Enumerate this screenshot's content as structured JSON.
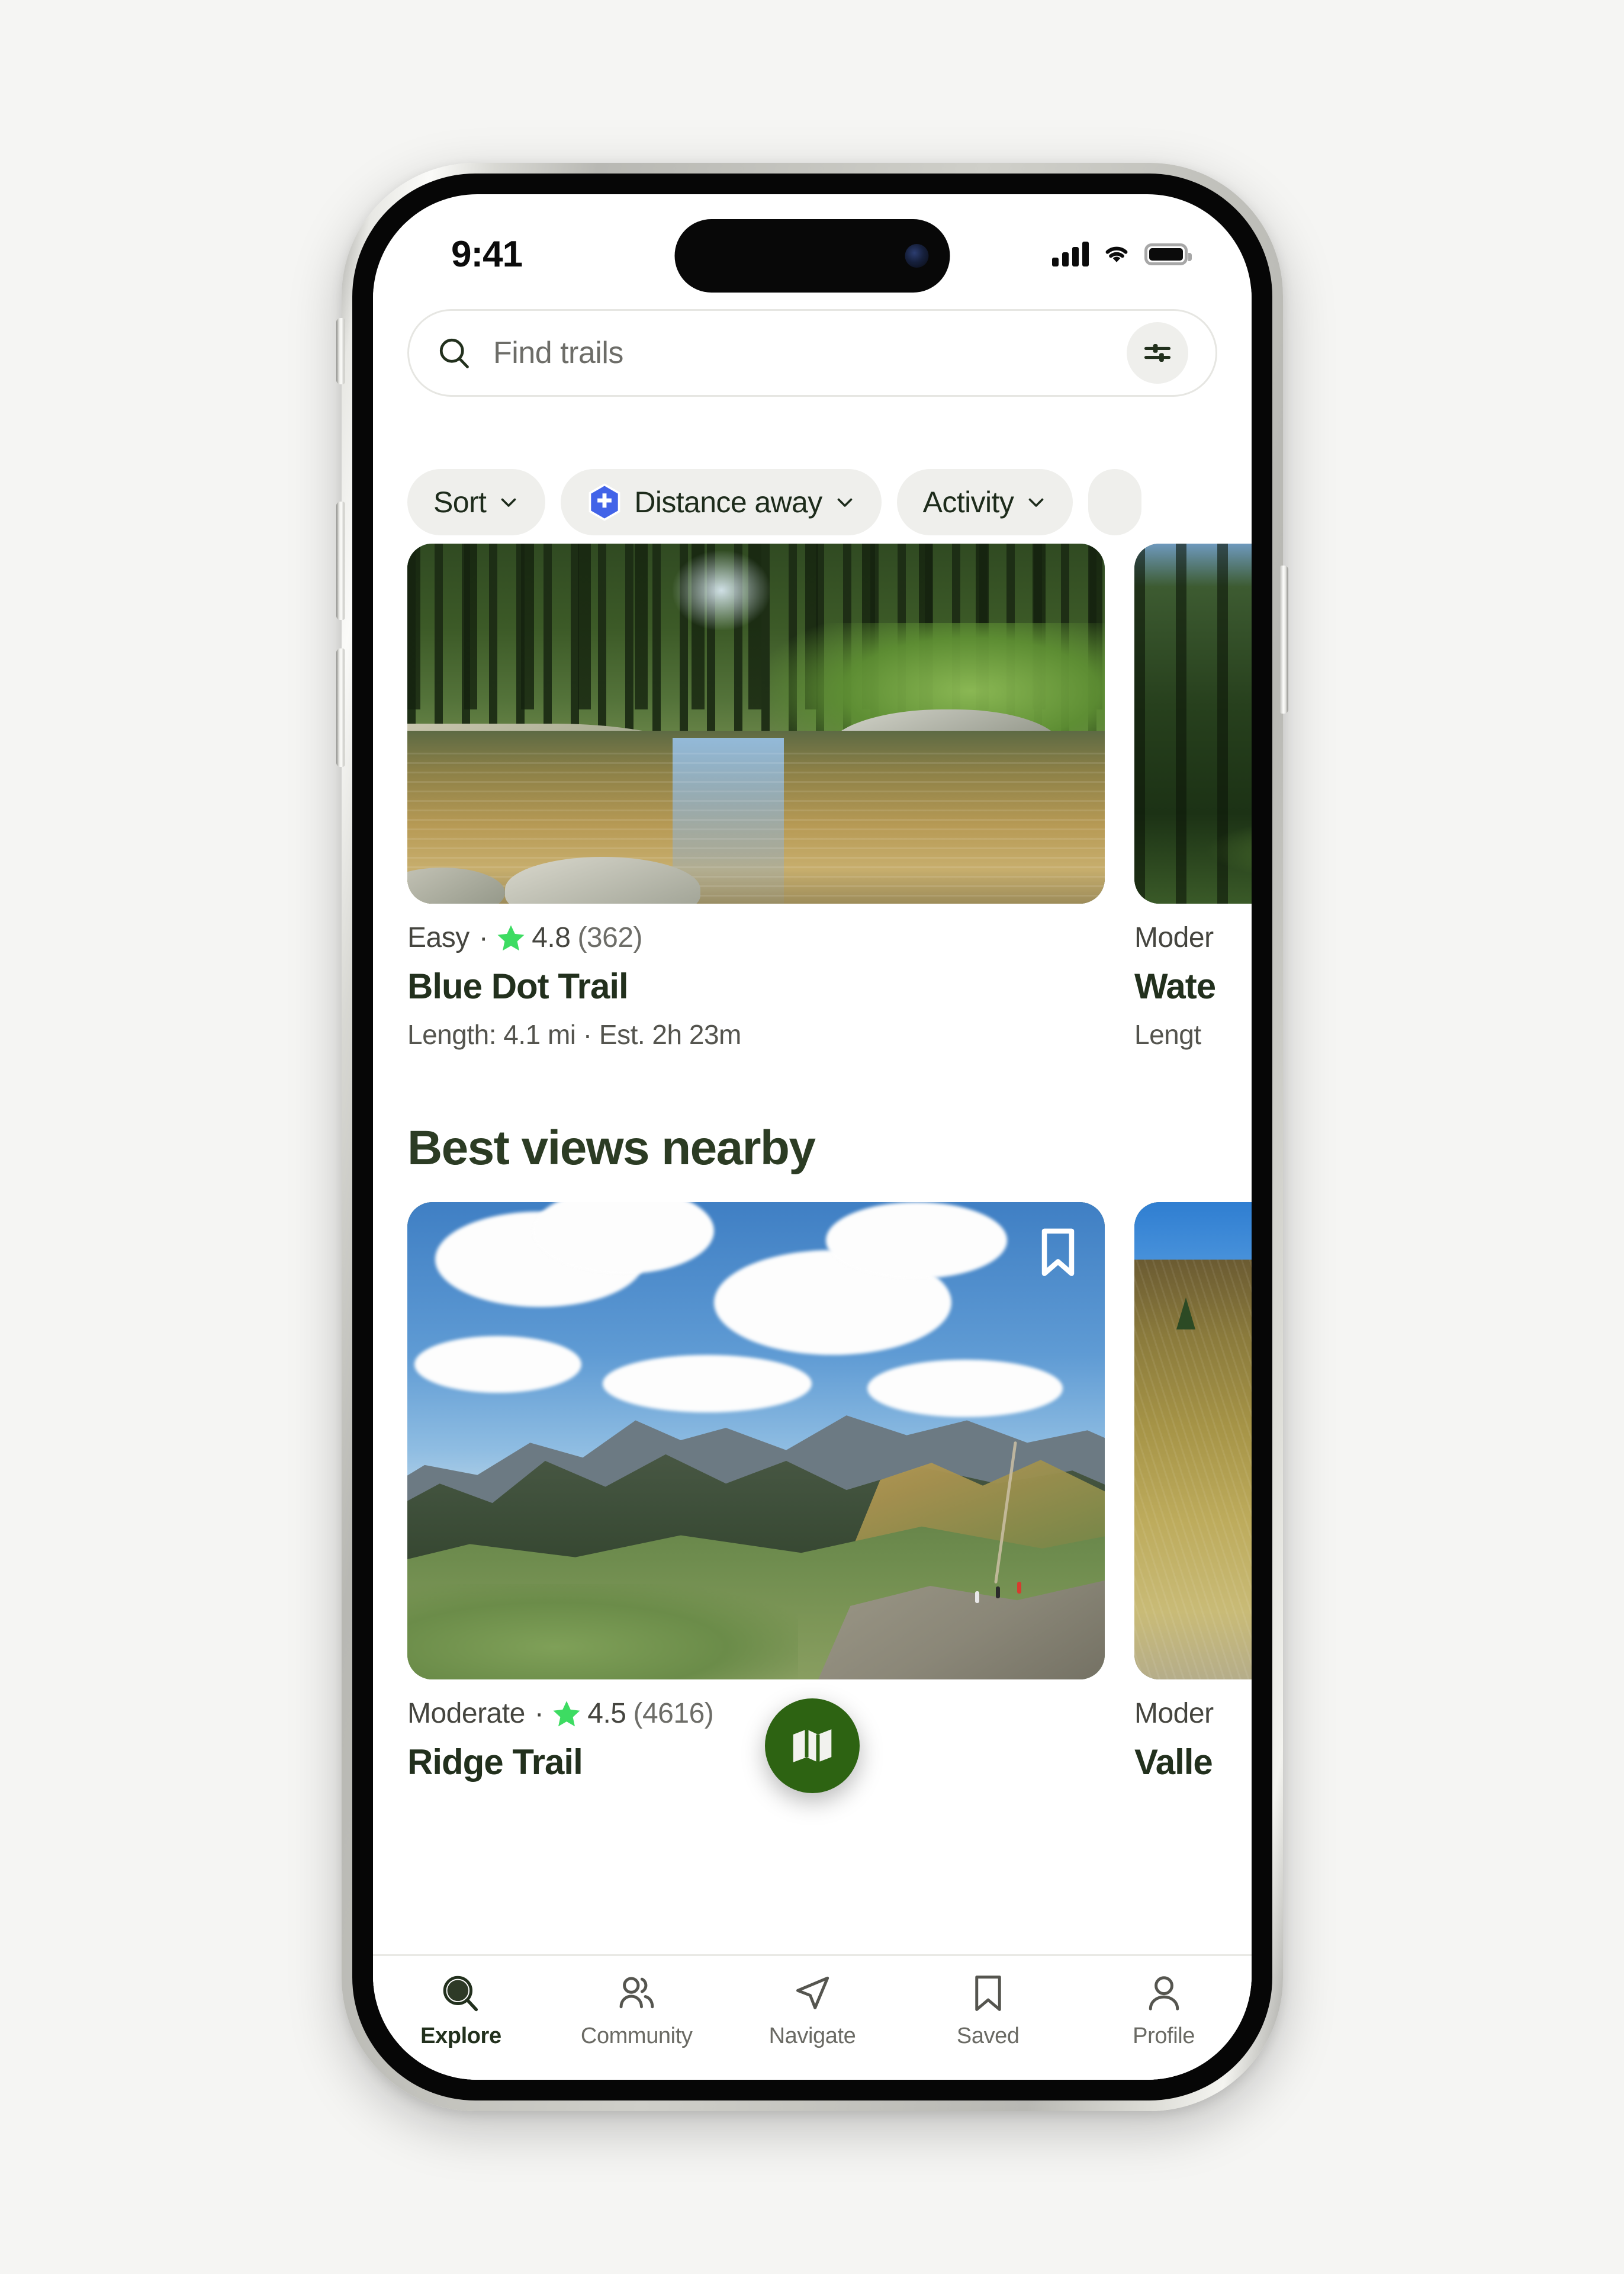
{
  "status_bar": {
    "time": "9:41",
    "signal_icon": "cellular-signal-icon",
    "wifi_icon": "wifi-icon",
    "battery_icon": "battery-icon"
  },
  "search": {
    "placeholder": "Find trails",
    "value": "",
    "search_icon": "search-icon",
    "filter_icon": "sliders-filter-icon"
  },
  "filter_chips": [
    {
      "label": "Sort",
      "icon": null,
      "has_caret": true,
      "active": false
    },
    {
      "label": "Distance away",
      "icon": "hexagon-plus-icon",
      "has_caret": true,
      "active": true
    },
    {
      "label": "Activity",
      "icon": null,
      "has_caret": true,
      "active": false
    }
  ],
  "colors": {
    "accent_green": "#2d6312",
    "title_green": "#22301d",
    "heading_green": "#2c3c24",
    "star_green": "#3ddc62",
    "chip_bg": "#efefec",
    "distance_badge_blue": "#4263e8"
  },
  "trail_section": {
    "cards": [
      {
        "difficulty": "Easy",
        "separator": "·",
        "rating": "4.8",
        "review_count": "(362)",
        "title": "Blue Dot Trail",
        "details": "Length: 4.1 mi · Est. 2h 23m",
        "photo": "forest-stream-photo"
      },
      {
        "difficulty": "Moder",
        "separator": "",
        "rating": "",
        "review_count": "",
        "title": "Wate",
        "details": "Lengt",
        "photo": "dark-forest-photo"
      }
    ]
  },
  "views_section": {
    "heading": "Best views nearby",
    "cards": [
      {
        "difficulty": "Moderate",
        "separator": "·",
        "rating": "4.5",
        "review_count": "(4616)",
        "title": "Ridge Trail",
        "photo": "mountain-ridge-photo",
        "bookmark_icon": "bookmark-icon"
      },
      {
        "difficulty": "Moder",
        "separator": "",
        "rating": "",
        "review_count": "",
        "title": "Valle",
        "photo": "golden-tundra-photo",
        "bookmark_icon": null
      }
    ]
  },
  "map_fab": {
    "icon": "map-icon",
    "label": "Map"
  },
  "tab_bar": {
    "tabs": [
      {
        "label": "Explore",
        "icon": "search-filled-icon",
        "active": true
      },
      {
        "label": "Community",
        "icon": "people-icon",
        "active": false
      },
      {
        "label": "Navigate",
        "icon": "navigation-arrow-icon",
        "active": false
      },
      {
        "label": "Saved",
        "icon": "bookmark-outline-icon",
        "active": false
      },
      {
        "label": "Profile",
        "icon": "person-icon",
        "active": false
      }
    ]
  }
}
